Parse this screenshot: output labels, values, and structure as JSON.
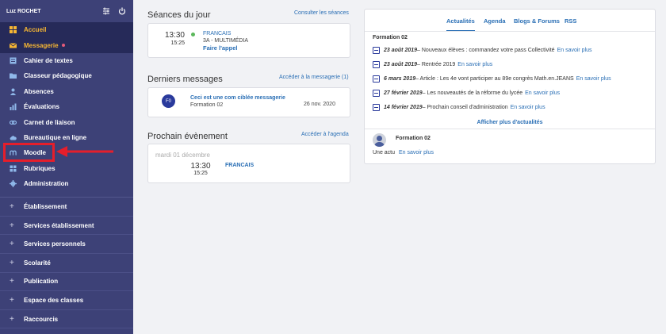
{
  "sidebar": {
    "user": "Luz ROCHET",
    "icons": {
      "settings": "sliders-icon",
      "power": "power-icon"
    },
    "nav": [
      {
        "label": "Accueil",
        "icon": "home-icon",
        "active": true
      },
      {
        "label": "Messagerie",
        "icon": "mail-icon",
        "active": true,
        "badge": true
      },
      {
        "label": "Cahier de textes",
        "icon": "book-icon"
      },
      {
        "label": "Classeur pédagogique",
        "icon": "folder-icon"
      },
      {
        "label": "Absences",
        "icon": "person-icon"
      },
      {
        "label": "Évaluations",
        "icon": "chart-icon"
      },
      {
        "label": "Carnet de liaison",
        "icon": "link-icon"
      },
      {
        "label": "Bureautique en ligne",
        "icon": "cloud-icon"
      },
      {
        "label": "Moodle",
        "icon": "moodle-icon"
      },
      {
        "label": "Rubriques",
        "icon": "dashboard-icon"
      },
      {
        "label": "Administration",
        "icon": "gear-icon"
      }
    ],
    "sections": [
      "Établissement",
      "Services établissement",
      "Services personnels",
      "Scolarité",
      "Publication",
      "Espace des classes",
      "Raccourcis"
    ]
  },
  "seances": {
    "title": "Séances du jour",
    "link": "Consulter les séances",
    "start": "13:30",
    "end": "15:25",
    "subject": "FRANCAIS",
    "class": "3A - MULTIMÉDIA",
    "action": "Faire l'appel"
  },
  "messages": {
    "title": "Derniers messages",
    "link": "Accéder à la messagerie (1)",
    "avatar": "F0",
    "subject": "Ceci est une com ciblée messagerie",
    "from": "Formation 02",
    "date": "26 nov. 2020"
  },
  "event": {
    "title": "Prochain évènement",
    "link": "Accéder à l'agenda",
    "date": "mardi 01 décembre",
    "start": "13:30",
    "end": "15:25",
    "subject": "FRANCAIS"
  },
  "news": {
    "tabs": [
      "Actualités",
      "Agenda",
      "Blogs & Forums",
      "RSS"
    ],
    "heading": "Formation 02",
    "items": [
      {
        "date": "23 août 2019",
        "text": " – Nouveaux élèves : commandez votre pass Collectivité",
        "link": "En savoir plus"
      },
      {
        "date": "23 août 2019",
        "text": " – Rentrée 2019",
        "link": "En savoir plus"
      },
      {
        "date": "6 mars 2019",
        "text": " – Article : Les 4e vont participer au 89e congrès Math.en.JEANS",
        "link": "En savoir plus"
      },
      {
        "date": "27 février 2019",
        "text": " – Les nouveautés de la réforme du lycée",
        "link": "En savoir plus"
      },
      {
        "date": "14 février 2019",
        "text": " – Prochain conseil d'administration",
        "link": "En savoir plus"
      }
    ],
    "more": "Afficher plus d'actualités",
    "footer_title": "Formation 02",
    "footer_text": "Une actu",
    "footer_link": "En savoir plus"
  },
  "colors": {
    "sidebar": "#3d4177",
    "active": "#f7b733",
    "link": "#2a6fb5",
    "highlight": "#e61e2b"
  }
}
